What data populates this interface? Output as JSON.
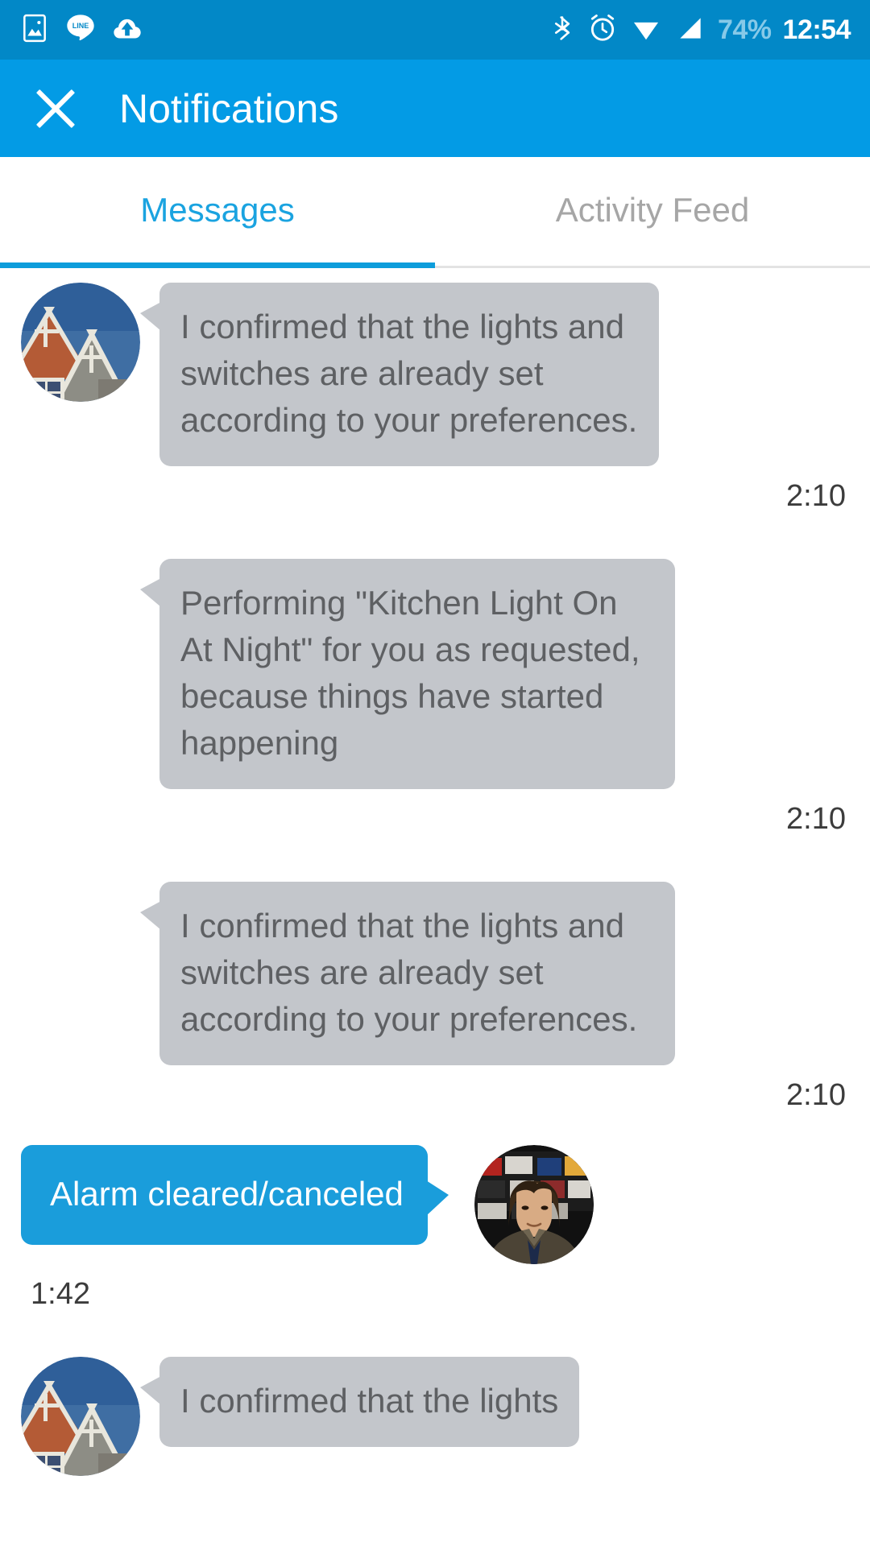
{
  "status_bar": {
    "left_icons": [
      "image-icon",
      "line-app-icon",
      "cloud-upload-icon"
    ],
    "right_icons": [
      "bluetooth-icon",
      "alarm-icon",
      "wifi-icon",
      "signal-icon"
    ],
    "battery": "74%",
    "clock": "12:54",
    "bg_color": "#0288c7"
  },
  "app_bar": {
    "close_label": "close-icon",
    "title": "Notifications",
    "bg_color": "#039be5"
  },
  "tabs": {
    "active_index": 0,
    "active_color": "#1aa3e0",
    "inactive_color": "#a6a6a6",
    "indicator_color": "#0d9ddb",
    "items": [
      {
        "label": "Messages"
      },
      {
        "label": "Activity Feed"
      }
    ]
  },
  "conversation": {
    "bubble_incoming_color": "#c3c6cb",
    "bubble_outgoing_color": "#1a9ddb",
    "messages": [
      {
        "direction": "incoming",
        "avatar": "house-photo-avatar",
        "text": "I confirmed that the lights and switches are already set according to your preferences.",
        "time": "2:10",
        "show_avatar": true
      },
      {
        "direction": "incoming",
        "avatar": "house-photo-avatar",
        "text": "Performing \"Kitchen Light On At Night\" for you as requested, because things have started happening",
        "time": "2:10",
        "show_avatar": false
      },
      {
        "direction": "incoming",
        "avatar": "house-photo-avatar",
        "text": "I confirmed that the lights and switches are already set according to your preferences.",
        "time": "2:10",
        "show_avatar": false
      },
      {
        "direction": "outgoing",
        "avatar": "person-photo-avatar",
        "text": "Alarm cleared/canceled",
        "time": "1:42",
        "show_avatar": true
      },
      {
        "direction": "incoming",
        "avatar": "house-photo-avatar",
        "text": "I confirmed that the lights",
        "time": "",
        "show_avatar": true
      }
    ]
  }
}
